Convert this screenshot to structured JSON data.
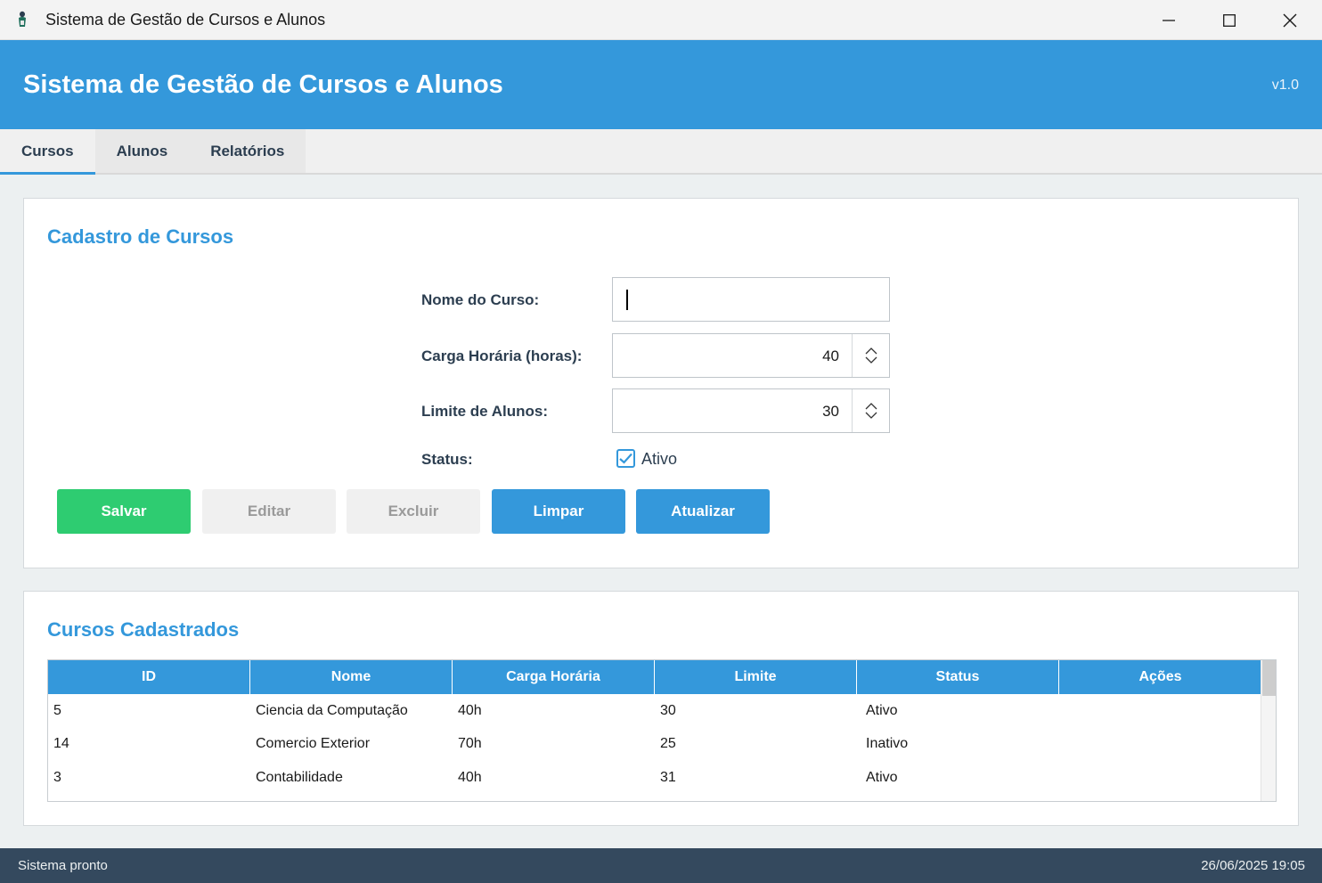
{
  "window": {
    "title": "Sistema de Gestão de Cursos e Alunos"
  },
  "header": {
    "title": "Sistema de Gestão de Cursos e Alunos",
    "version": "v1.0"
  },
  "tabs": [
    {
      "label": "Cursos",
      "active": true
    },
    {
      "label": "Alunos",
      "active": false
    },
    {
      "label": "Relatórios",
      "active": false
    }
  ],
  "form": {
    "title": "Cadastro de Cursos",
    "nome_label": "Nome do Curso:",
    "nome_value": "",
    "carga_label": "Carga Horária (horas):",
    "carga_value": "40",
    "limite_label": "Limite de Alunos:",
    "limite_value": "30",
    "status_label": "Status:",
    "ativo_label": "Ativo",
    "ativo_checked": true,
    "buttons": {
      "salvar": "Salvar",
      "editar": "Editar",
      "excluir": "Excluir",
      "limpar": "Limpar",
      "atualizar": "Atualizar"
    }
  },
  "list": {
    "title": "Cursos Cadastrados",
    "columns": [
      "ID",
      "Nome",
      "Carga Horária",
      "Limite",
      "Status",
      "Ações"
    ],
    "rows": [
      [
        "5",
        "Ciencia da Computação",
        "40h",
        "30",
        "Ativo",
        ""
      ],
      [
        "14",
        "Comercio Exterior",
        "70h",
        "25",
        "Inativo",
        ""
      ],
      [
        "3",
        "Contabilidade",
        "40h",
        "31",
        "Ativo",
        ""
      ]
    ]
  },
  "status_bar": {
    "message": "Sistema pronto",
    "datetime": "26/06/2025 19:05"
  },
  "colors": {
    "primary": "#3498db",
    "success": "#2ecc71",
    "dark": "#34495e"
  }
}
